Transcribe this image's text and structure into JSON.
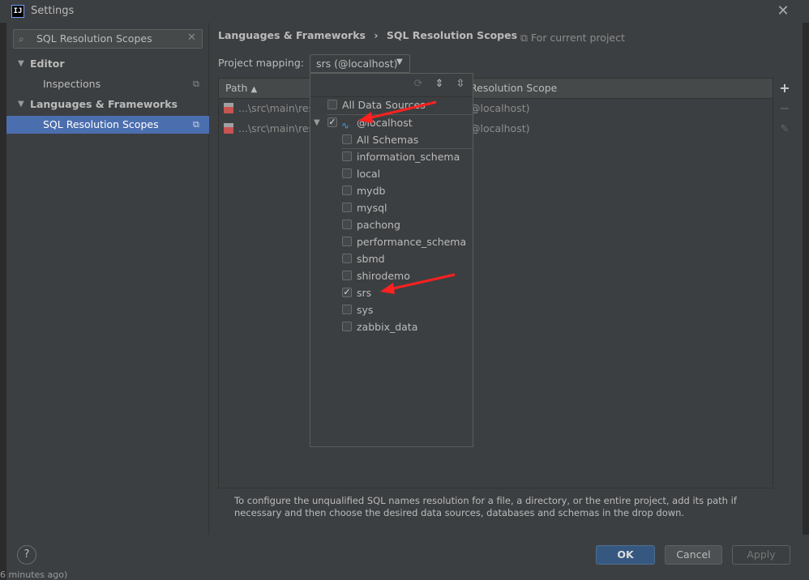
{
  "window": {
    "title": "Settings",
    "app_icon_text": "IJ"
  },
  "sidebar": {
    "search_value": "SQL Resolution Scopes",
    "items": [
      {
        "label": "Editor",
        "type": "group"
      },
      {
        "label": "Inspections",
        "type": "child"
      },
      {
        "label": "Languages & Frameworks",
        "type": "group"
      },
      {
        "label": "SQL Resolution Scopes",
        "type": "child",
        "selected": true
      }
    ]
  },
  "breadcrumb": {
    "parent": "Languages & Frameworks",
    "separator": "›",
    "current": "SQL Resolution Scopes"
  },
  "project_note": "For current project",
  "mapping": {
    "label": "Project mapping:",
    "value": "srs (@localhost)"
  },
  "table": {
    "columns": [
      "Path",
      "Resolution Scope"
    ],
    "rows": [
      {
        "path": "...\\src\\main\\res",
        "scope": "@localhost)"
      },
      {
        "path": "...\\src\\main\\res",
        "scope": "@localhost)"
      }
    ]
  },
  "hint": "To configure the unqualified SQL names resolution for a file, a directory, or the entire project, add its path if necessary and then choose the desired data sources, databases and schemas in the drop down.",
  "popup": {
    "all_data_sources": "All Data Sources",
    "datasource": "@localhost",
    "all_schemas": "All Schemas",
    "schemas": [
      {
        "name": "information_schema",
        "checked": false
      },
      {
        "name": "local",
        "checked": false
      },
      {
        "name": "mydb",
        "checked": false
      },
      {
        "name": "mysql",
        "checked": false
      },
      {
        "name": "pachong",
        "checked": false
      },
      {
        "name": "performance_schema",
        "checked": false
      },
      {
        "name": "sbmd",
        "checked": false
      },
      {
        "name": "shirodemo",
        "checked": false
      },
      {
        "name": "srs",
        "checked": true
      },
      {
        "name": "sys",
        "checked": false
      },
      {
        "name": "zabbix_data",
        "checked": false
      }
    ]
  },
  "buttons": {
    "ok": "OK",
    "cancel": "Cancel",
    "apply": "Apply",
    "help": "?"
  },
  "status_text": "6 minutes ago)",
  "colors": {
    "accent": "#4b6eaf",
    "ok_button": "#365880",
    "annotation_arrow": "#ff2020"
  }
}
